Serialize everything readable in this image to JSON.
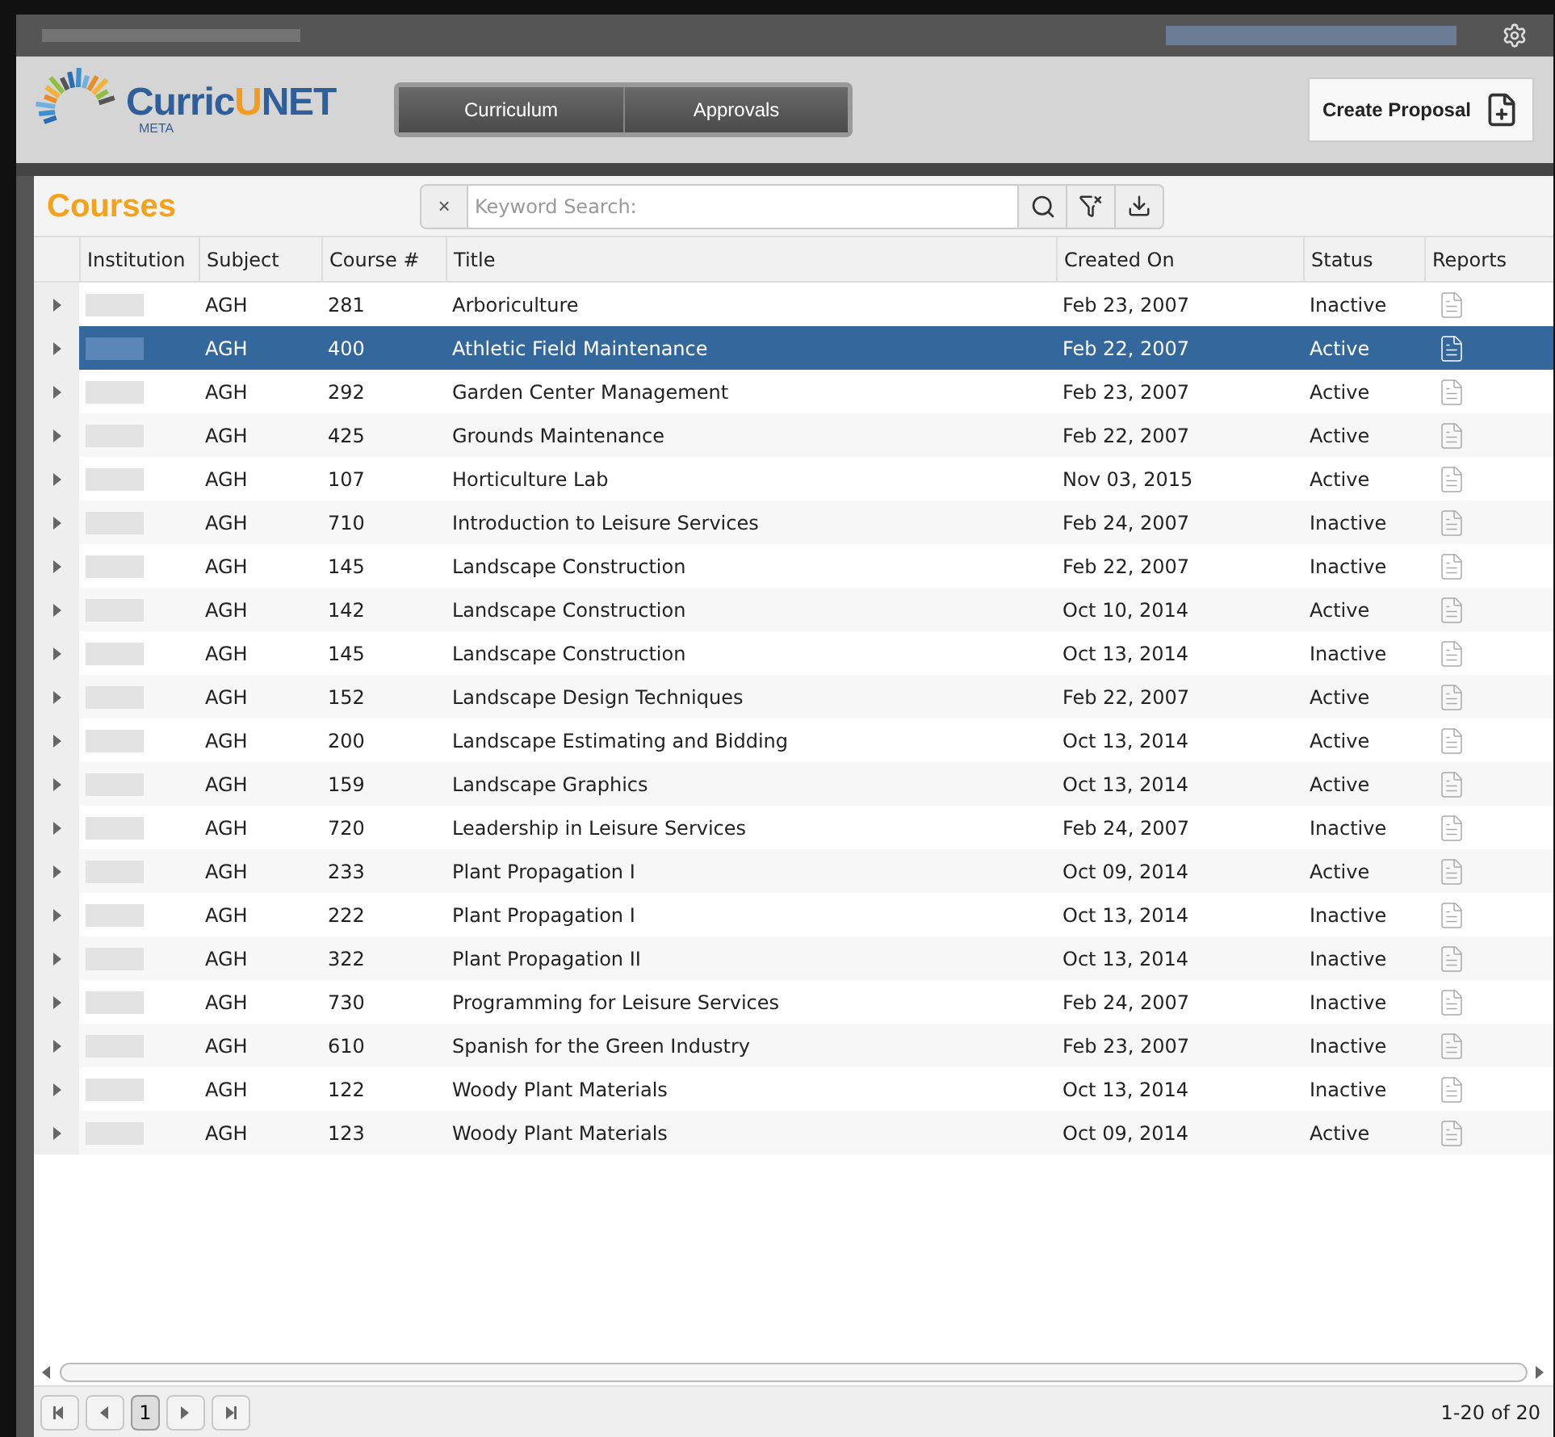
{
  "logo": {
    "parts": [
      "Curric",
      "U",
      "NET"
    ],
    "sub": "META"
  },
  "nav": [
    "Curriculum",
    "Approvals"
  ],
  "create_button": "Create Proposal",
  "panel": {
    "title": "Courses",
    "search": {
      "placeholder": "Keyword Search:",
      "clear": "×"
    }
  },
  "table": {
    "columns": [
      "Institution",
      "Subject",
      "Course #",
      "Title",
      "Created On",
      "Status",
      "Reports"
    ],
    "rows": [
      {
        "subject": "AGH",
        "course": "281",
        "title": "Arboriculture",
        "created": "Feb 23, 2007",
        "status": "Inactive",
        "selected": false
      },
      {
        "subject": "AGH",
        "course": "400",
        "title": "Athletic Field Maintenance",
        "created": "Feb 22, 2007",
        "status": "Active",
        "selected": true
      },
      {
        "subject": "AGH",
        "course": "292",
        "title": "Garden Center Management",
        "created": "Feb 23, 2007",
        "status": "Active",
        "selected": false
      },
      {
        "subject": "AGH",
        "course": "425",
        "title": "Grounds Maintenance",
        "created": "Feb 22, 2007",
        "status": "Active",
        "selected": false
      },
      {
        "subject": "AGH",
        "course": "107",
        "title": "Horticulture Lab",
        "created": "Nov 03, 2015",
        "status": "Active",
        "selected": false
      },
      {
        "subject": "AGH",
        "course": "710",
        "title": "Introduction to Leisure Services",
        "created": "Feb 24, 2007",
        "status": "Inactive",
        "selected": false
      },
      {
        "subject": "AGH",
        "course": "145",
        "title": "Landscape Construction",
        "created": "Feb 22, 2007",
        "status": "Inactive",
        "selected": false
      },
      {
        "subject": "AGH",
        "course": "142",
        "title": "Landscape Construction",
        "created": "Oct 10, 2014",
        "status": "Active",
        "selected": false
      },
      {
        "subject": "AGH",
        "course": "145",
        "title": "Landscape Construction",
        "created": "Oct 13, 2014",
        "status": "Inactive",
        "selected": false
      },
      {
        "subject": "AGH",
        "course": "152",
        "title": "Landscape Design Techniques",
        "created": "Feb 22, 2007",
        "status": "Active",
        "selected": false
      },
      {
        "subject": "AGH",
        "course": "200",
        "title": "Landscape Estimating and Bidding",
        "created": "Oct 13, 2014",
        "status": "Active",
        "selected": false
      },
      {
        "subject": "AGH",
        "course": "159",
        "title": "Landscape Graphics",
        "created": "Oct 13, 2014",
        "status": "Active",
        "selected": false
      },
      {
        "subject": "AGH",
        "course": "720",
        "title": "Leadership in Leisure Services",
        "created": "Feb 24, 2007",
        "status": "Inactive",
        "selected": false
      },
      {
        "subject": "AGH",
        "course": "233",
        "title": "Plant Propagation I",
        "created": "Oct 09, 2014",
        "status": "Active",
        "selected": false
      },
      {
        "subject": "AGH",
        "course": "222",
        "title": "Plant Propagation I",
        "created": "Oct 13, 2014",
        "status": "Inactive",
        "selected": false
      },
      {
        "subject": "AGH",
        "course": "322",
        "title": "Plant Propagation II",
        "created": "Oct 13, 2014",
        "status": "Inactive",
        "selected": false
      },
      {
        "subject": "AGH",
        "course": "730",
        "title": "Programming for Leisure Services",
        "created": "Feb 24, 2007",
        "status": "Inactive",
        "selected": false
      },
      {
        "subject": "AGH",
        "course": "610",
        "title": "Spanish for the Green Industry",
        "created": "Feb 23, 2007",
        "status": "Inactive",
        "selected": false
      },
      {
        "subject": "AGH",
        "course": "122",
        "title": "Woody Plant Materials",
        "created": "Oct 13, 2014",
        "status": "Inactive",
        "selected": false
      },
      {
        "subject": "AGH",
        "course": "123",
        "title": "Woody Plant Materials",
        "created": "Oct 09, 2014",
        "status": "Active",
        "selected": false
      }
    ]
  },
  "pager": {
    "current_page": "1",
    "summary": "1-20 of 20"
  }
}
